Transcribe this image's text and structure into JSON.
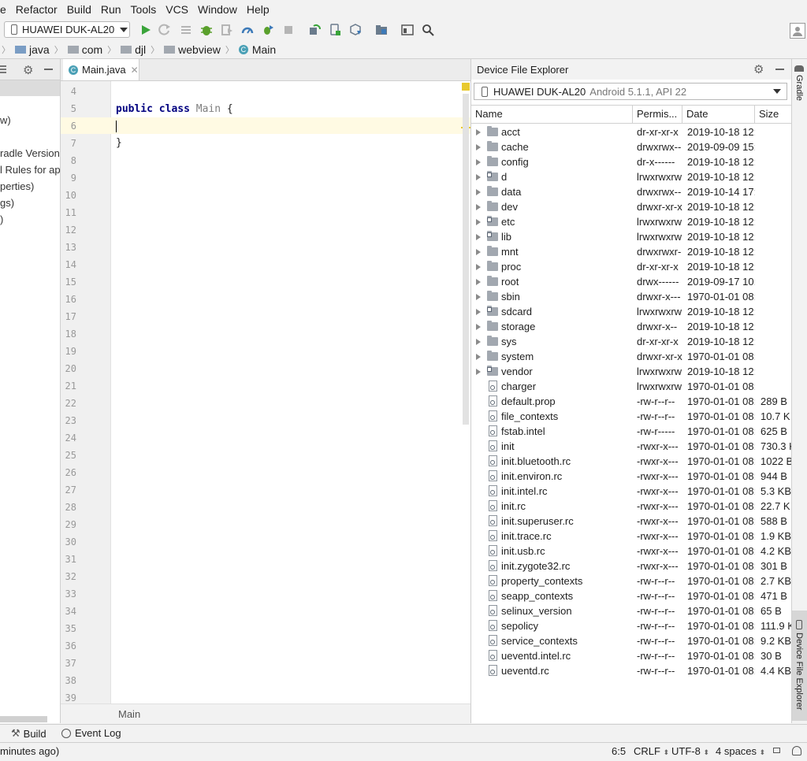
{
  "menu": [
    "e",
    "Refactor",
    "Build",
    "Run",
    "Tools",
    "VCS",
    "Window",
    "Help"
  ],
  "toolbar": {
    "device": "HUAWEI DUK-AL20",
    "icons": [
      "run-icon",
      "rerun-icon",
      "coverage-icon",
      "debug-icon",
      "attach-icon",
      "profile-icon",
      "apply-changes-icon",
      "stop-icon",
      "sync-icon",
      "avd-manager-icon",
      "sdk-manager-icon",
      "project-structure-icon",
      "layout-icon",
      "search-icon"
    ]
  },
  "breadcrumb": [
    "java",
    "com",
    "djl",
    "webview",
    "Main"
  ],
  "project_panel": {
    "lines": [
      "w)",
      "radle Version",
      "l Rules for ap",
      "perties)",
      "gs)",
      ")"
    ]
  },
  "editor": {
    "tab": "Main.java",
    "footer": "Main",
    "line_numbers": [
      "4",
      "5",
      "6",
      "7",
      "8",
      "9",
      "10",
      "11",
      "12",
      "13",
      "14",
      "15",
      "16",
      "17",
      "18",
      "19",
      "20",
      "21",
      "22",
      "23",
      "24",
      "25",
      "26",
      "27",
      "28",
      "29",
      "30",
      "31",
      "32",
      "33",
      "34",
      "35",
      "36",
      "37",
      "38",
      "39"
    ],
    "code": {
      "keyword1": "public",
      "keyword2": "class",
      "class_name": "Main",
      "open_brace": "{",
      "close_brace": "}"
    }
  },
  "device_explorer": {
    "title": "Device File Explorer",
    "device_name": "HUAWEI DUK-AL20",
    "device_detail": "Android 5.1.1, API 22",
    "columns": [
      "Name",
      "Permis...",
      "Date",
      "Size"
    ],
    "rows": [
      {
        "name": "acct",
        "perm": "dr-xr-xr-x",
        "date": "2019-10-18 12:",
        "size": "",
        "kind": "folder"
      },
      {
        "name": "cache",
        "perm": "drwxrwx--",
        "date": "2019-09-09 15:",
        "size": "",
        "kind": "folder"
      },
      {
        "name": "config",
        "perm": "dr-x------",
        "date": "2019-10-18 12:",
        "size": "",
        "kind": "folder"
      },
      {
        "name": "d",
        "perm": "lrwxrwxrw",
        "date": "2019-10-18 12:",
        "size": "",
        "kind": "link"
      },
      {
        "name": "data",
        "perm": "drwxrwx--",
        "date": "2019-10-14 17:",
        "size": "",
        "kind": "folder"
      },
      {
        "name": "dev",
        "perm": "drwxr-xr-x",
        "date": "2019-10-18 12:",
        "size": "",
        "kind": "folder"
      },
      {
        "name": "etc",
        "perm": "lrwxrwxrw",
        "date": "2019-10-18 12:",
        "size": "",
        "kind": "link"
      },
      {
        "name": "lib",
        "perm": "lrwxrwxrw",
        "date": "2019-10-18 12:",
        "size": "",
        "kind": "link"
      },
      {
        "name": "mnt",
        "perm": "drwxrwxr-",
        "date": "2019-10-18 12:",
        "size": "",
        "kind": "folder"
      },
      {
        "name": "proc",
        "perm": "dr-xr-xr-x",
        "date": "2019-10-18 12:",
        "size": "",
        "kind": "folder"
      },
      {
        "name": "root",
        "perm": "drwx------",
        "date": "2019-09-17 10:",
        "size": "",
        "kind": "folder"
      },
      {
        "name": "sbin",
        "perm": "drwxr-x---",
        "date": "1970-01-01 08:",
        "size": "",
        "kind": "folder"
      },
      {
        "name": "sdcard",
        "perm": "lrwxrwxrw",
        "date": "2019-10-18 12:",
        "size": "",
        "kind": "link"
      },
      {
        "name": "storage",
        "perm": "drwxr-x--",
        "date": "2019-10-18 12:",
        "size": "",
        "kind": "folder"
      },
      {
        "name": "sys",
        "perm": "dr-xr-xr-x",
        "date": "2019-10-18 12:",
        "size": "",
        "kind": "folder"
      },
      {
        "name": "system",
        "perm": "drwxr-xr-x",
        "date": "1970-01-01 08:",
        "size": "",
        "kind": "folder"
      },
      {
        "name": "vendor",
        "perm": "lrwxrwxrw",
        "date": "2019-10-18 12:",
        "size": "",
        "kind": "link"
      },
      {
        "name": "charger",
        "perm": "lrwxrwxrw",
        "date": "1970-01-01 08:",
        "size": "",
        "kind": "file"
      },
      {
        "name": "default.prop",
        "perm": "-rw-r--r--",
        "date": "1970-01-01 08:",
        "size": "289 B",
        "kind": "file"
      },
      {
        "name": "file_contexts",
        "perm": "-rw-r--r--",
        "date": "1970-01-01 08:",
        "size": "10.7 K",
        "kind": "file"
      },
      {
        "name": "fstab.intel",
        "perm": "-rw-r-----",
        "date": "1970-01-01 08:",
        "size": "625 B",
        "kind": "file"
      },
      {
        "name": "init",
        "perm": "-rwxr-x---",
        "date": "1970-01-01 08:",
        "size": "730.3 K",
        "kind": "file"
      },
      {
        "name": "init.bluetooth.rc",
        "perm": "-rwxr-x---",
        "date": "1970-01-01 08:",
        "size": "1022 B",
        "kind": "file"
      },
      {
        "name": "init.environ.rc",
        "perm": "-rwxr-x---",
        "date": "1970-01-01 08:",
        "size": "944 B",
        "kind": "file"
      },
      {
        "name": "init.intel.rc",
        "perm": "-rwxr-x---",
        "date": "1970-01-01 08:",
        "size": "5.3 KB",
        "kind": "file"
      },
      {
        "name": "init.rc",
        "perm": "-rwxr-x---",
        "date": "1970-01-01 08:",
        "size": "22.7 K",
        "kind": "file"
      },
      {
        "name": "init.superuser.rc",
        "perm": "-rwxr-x---",
        "date": "1970-01-01 08:",
        "size": "588 B",
        "kind": "file"
      },
      {
        "name": "init.trace.rc",
        "perm": "-rwxr-x---",
        "date": "1970-01-01 08:",
        "size": "1.9 KB",
        "kind": "file"
      },
      {
        "name": "init.usb.rc",
        "perm": "-rwxr-x---",
        "date": "1970-01-01 08:",
        "size": "4.2 KB",
        "kind": "file"
      },
      {
        "name": "init.zygote32.rc",
        "perm": "-rwxr-x---",
        "date": "1970-01-01 08:",
        "size": "301 B",
        "kind": "file"
      },
      {
        "name": "property_contexts",
        "perm": "-rw-r--r--",
        "date": "1970-01-01 08:",
        "size": "2.7 KB",
        "kind": "file"
      },
      {
        "name": "seapp_contexts",
        "perm": "-rw-r--r--",
        "date": "1970-01-01 08:",
        "size": "471 B",
        "kind": "file"
      },
      {
        "name": "selinux_version",
        "perm": "-rw-r--r--",
        "date": "1970-01-01 08:",
        "size": "65 B",
        "kind": "file"
      },
      {
        "name": "sepolicy",
        "perm": "-rw-r--r--",
        "date": "1970-01-01 08:",
        "size": "111.9 K",
        "kind": "file"
      },
      {
        "name": "service_contexts",
        "perm": "-rw-r--r--",
        "date": "1970-01-01 08:",
        "size": "9.2 KB",
        "kind": "file"
      },
      {
        "name": "ueventd.intel.rc",
        "perm": "-rw-r--r--",
        "date": "1970-01-01 08:",
        "size": "30 B",
        "kind": "file"
      },
      {
        "name": "ueventd.rc",
        "perm": "-rw-r--r--",
        "date": "1970-01-01 08:",
        "size": "4.4 KB",
        "kind": "file"
      }
    ]
  },
  "right_strip": {
    "gradle": "Gradle",
    "device_file_explorer": "Device File Explorer"
  },
  "tool_windows": {
    "build": "Build",
    "event_log": "Event Log"
  },
  "status": {
    "message": "minutes ago)",
    "position": "6:5",
    "line_sep": "CRLF",
    "encoding": "UTF-8",
    "indent": "4 spaces"
  },
  "colors": {
    "run_green": "#3aa43a",
    "debug_green": "#5aa02c",
    "keyword": "#000080",
    "caret_line": "#fffae3"
  }
}
